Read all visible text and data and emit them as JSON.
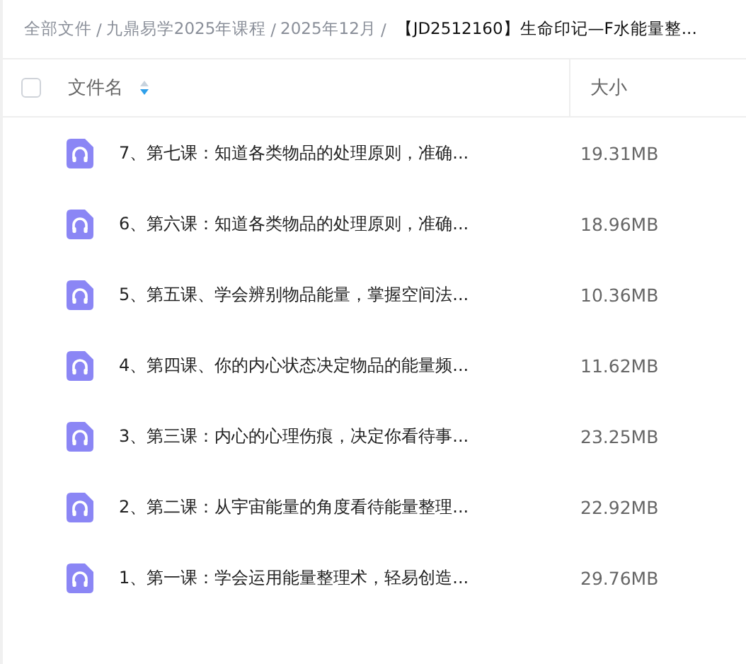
{
  "breadcrumb": [
    {
      "label": "全部文件",
      "current": false
    },
    {
      "label": "九鼎易学2025年课程",
      "current": false
    },
    {
      "label": "2025年12月",
      "current": false
    },
    {
      "label": "【JD2512160】生命印记—F水能量整...",
      "current": true
    }
  ],
  "breadcrumb_separator": "/",
  "table": {
    "select_all": {
      "checked": false
    },
    "columns": [
      {
        "label": "文件名",
        "sorted": true
      },
      {
        "label": "大小",
        "sorted": false
      }
    ],
    "rows": [
      {
        "kind": "audio",
        "name": "7、第七课：知道各类物品的处理原则，准确...",
        "size": "19.31MB"
      },
      {
        "kind": "audio",
        "name": "6、第六课：知道各类物品的处理原则，准确...",
        "size": "18.96MB"
      },
      {
        "kind": "audio",
        "name": "5、第五课、学会辨别物品能量，掌握空间法...",
        "size": "10.36MB"
      },
      {
        "kind": "audio",
        "name": "4、第四课、你的内心状态决定物品的能量频...",
        "size": "11.62MB"
      },
      {
        "kind": "audio",
        "name": "3、第三课：内心的心理伤痕，决定你看待事...",
        "size": "23.25MB"
      },
      {
        "kind": "audio",
        "name": "2、第二课：从宇宙能量的角度看待能量整理...",
        "size": "22.92MB"
      },
      {
        "kind": "audio",
        "name": "1、第一课：学会运用能量整理术，轻易创造...",
        "size": "29.76MB"
      }
    ]
  }
}
